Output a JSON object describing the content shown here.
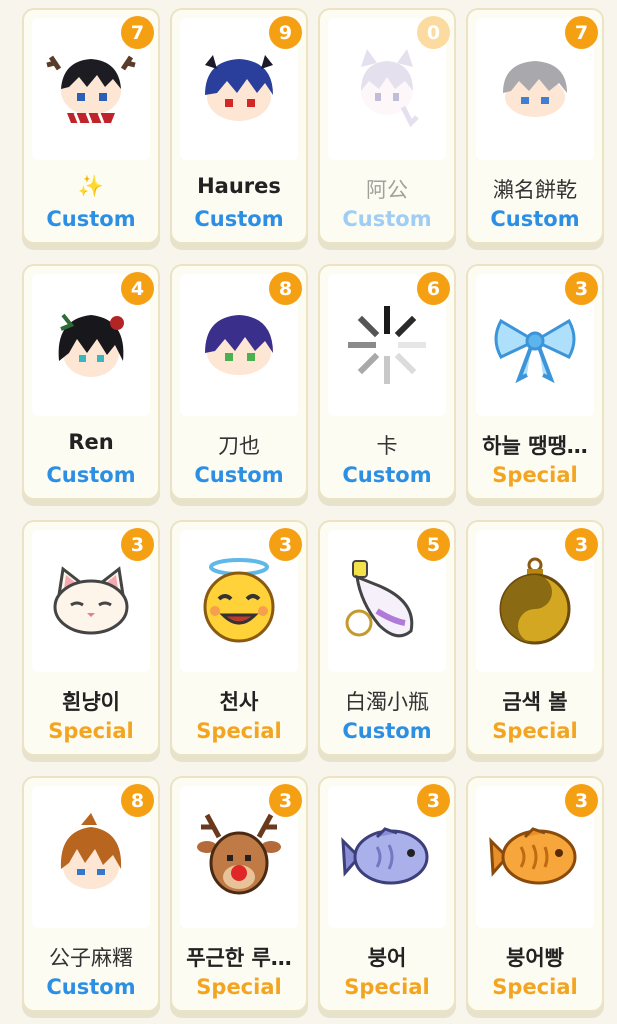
{
  "cards": [
    {
      "name": "✨",
      "badge": "7",
      "label": "Custom",
      "icon": "deer-antler-boy-icon"
    },
    {
      "name": "Haures",
      "badge": "9",
      "label": "Custom",
      "icon": "blue-hair-boy-icon"
    },
    {
      "name": "阿公",
      "badge": "0",
      "label": "Custom",
      "icon": "cat-ear-girl-icon"
    },
    {
      "name": "瀨名餅乾",
      "badge": "7",
      "label": "Custom",
      "icon": "silver-hair-boy-icon"
    },
    {
      "name": "Ren",
      "badge": "4",
      "label": "Custom",
      "icon": "black-hair-boy-icon"
    },
    {
      "name": "刀也",
      "badge": "8",
      "label": "Custom",
      "icon": "purple-hair-boy-icon"
    },
    {
      "name": "卡",
      "badge": "6",
      "label": "Custom",
      "icon": "loading-spinner-icon"
    },
    {
      "name": "하늘 땡땡…",
      "badge": "3",
      "label": "Special",
      "icon": "blue-bow-icon"
    },
    {
      "name": "흰냥이",
      "badge": "3",
      "label": "Special",
      "icon": "white-cat-icon"
    },
    {
      "name": "천사",
      "badge": "3",
      "label": "Special",
      "icon": "angel-smiley-icon"
    },
    {
      "name": "白濁小瓶",
      "badge": "5",
      "label": "Custom",
      "icon": "potion-bottle-icon"
    },
    {
      "name": "금색 볼",
      "badge": "3",
      "label": "Special",
      "icon": "gold-ornament-icon"
    },
    {
      "name": "公子麻糬",
      "badge": "8",
      "label": "Custom",
      "icon": "orange-hair-boy-icon"
    },
    {
      "name": "푸근한 루…",
      "badge": "3",
      "label": "Special",
      "icon": "reindeer-icon"
    },
    {
      "name": "붕어",
      "badge": "3",
      "label": "Special",
      "icon": "blue-fish-icon"
    },
    {
      "name": "붕어빵",
      "badge": "3",
      "label": "Special",
      "icon": "fish-bread-icon"
    }
  ],
  "colors": {
    "custom": "#2d8fe4",
    "special": "#f3a521",
    "badge": "#f4a012"
  }
}
